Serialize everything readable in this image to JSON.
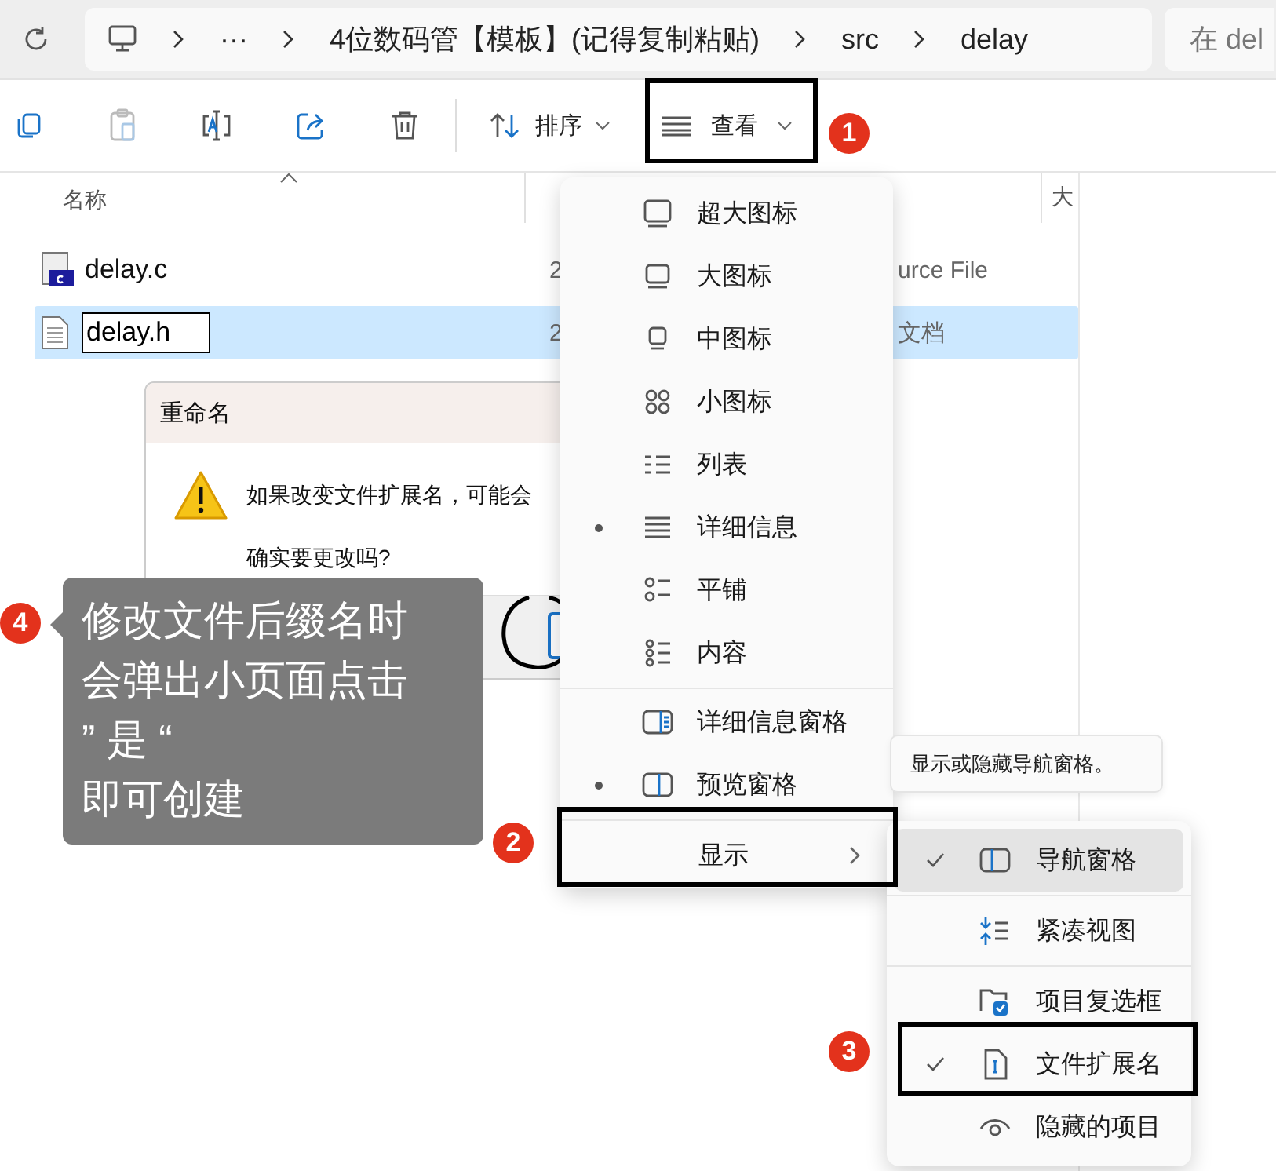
{
  "address_bar": {
    "overflow": "···",
    "path": [
      "4位数码管【模板】(记得复制粘贴)",
      "src",
      "delay"
    ]
  },
  "search": {
    "placeholder": "在 del"
  },
  "toolbar": {
    "sort": "排序",
    "view": "查看"
  },
  "file_list": {
    "columns": [
      "名称",
      "大"
    ],
    "rows": [
      {
        "kind": "source",
        "name": "delay.c",
        "date": "2",
        "type": "urce File",
        "selected": false,
        "editing": false
      },
      {
        "kind": "document",
        "name": "delay.h",
        "date": "2",
        "type": "文档",
        "selected": true,
        "editing": true
      }
    ]
  },
  "rename_dialog": {
    "title": "重命名",
    "message": "如果改变文件扩展名，可能会",
    "question": "确实要更改吗?"
  },
  "view_menu": {
    "groups": [
      {
        "items": [
          {
            "label": "超大图标",
            "selected": false
          },
          {
            "label": "大图标",
            "selected": false
          },
          {
            "label": "中图标",
            "selected": false
          },
          {
            "label": "小图标",
            "selected": false
          },
          {
            "label": "列表",
            "selected": false
          },
          {
            "label": "详细信息",
            "selected": true
          },
          {
            "label": "平铺",
            "selected": false
          },
          {
            "label": "内容",
            "selected": false
          }
        ]
      },
      {
        "items": [
          {
            "label": "详细信息窗格",
            "selected": false
          },
          {
            "label": "预览窗格",
            "selected": true
          }
        ]
      }
    ],
    "show": {
      "label": "显示"
    }
  },
  "tooltip": "显示或隐藏导航窗格。",
  "show_submenu": {
    "groups": [
      {
        "items": [
          {
            "label": "导航窗格",
            "checked": true,
            "hovered": true
          }
        ]
      },
      {
        "items": [
          {
            "label": "紧凑视图",
            "checked": false,
            "hovered": false
          }
        ]
      },
      {
        "items": [
          {
            "label": "项目复选框",
            "checked": false,
            "hovered": false
          },
          {
            "label": "文件扩展名",
            "checked": true,
            "hovered": false
          },
          {
            "label": "隐藏的项目",
            "checked": false,
            "hovered": false
          }
        ]
      }
    ]
  },
  "annotations": {
    "steps": [
      {
        "number": "1"
      },
      {
        "number": "2"
      },
      {
        "number": "3"
      },
      {
        "number": "4"
      }
    ],
    "note_lines": [
      "修改文件后缀名时",
      "会弹出小页面点击",
      "” 是 “",
      "即可创建"
    ]
  }
}
